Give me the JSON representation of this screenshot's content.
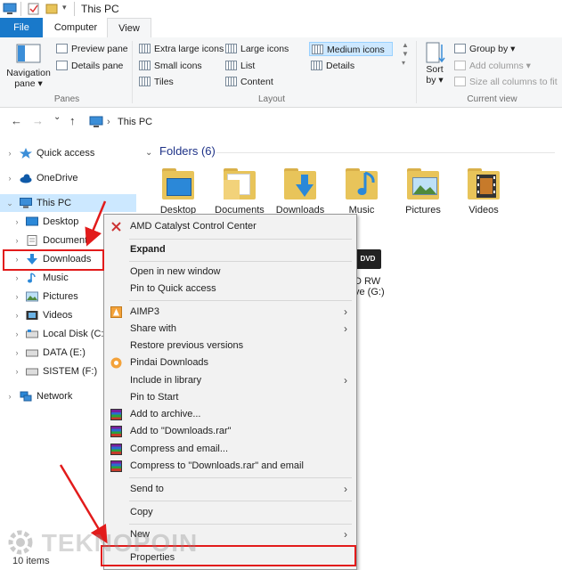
{
  "window": {
    "title": "This PC"
  },
  "ribbon_tabs": {
    "file": "File",
    "computer": "Computer",
    "view": "View"
  },
  "ribbon": {
    "panes": {
      "nav_pane_line1": "Navigation",
      "nav_pane_line2": "pane ▾",
      "preview_pane": "Preview pane",
      "details_pane": "Details pane",
      "label": "Panes"
    },
    "layout": {
      "extra_large": "Extra large icons",
      "large": "Large icons",
      "medium": "Medium icons",
      "small": "Small icons",
      "list": "List",
      "details": "Details",
      "tiles": "Tiles",
      "content": "Content",
      "label": "Layout"
    },
    "current_view": {
      "sort_line1": "Sort",
      "sort_line2": "by ▾",
      "group_by": "Group by ▾",
      "add_columns": "Add columns ▾",
      "size_all": "Size all columns to fit",
      "label": "Current view"
    }
  },
  "address": {
    "back": "←",
    "forward": "→",
    "dropdown": "⌄",
    "up": "↑",
    "sep": "›",
    "crumb": "This PC"
  },
  "nav": {
    "quick_access": "Quick access",
    "onedrive": "OneDrive",
    "this_pc": "This PC",
    "desktop": "Desktop",
    "documents": "Document",
    "downloads": "Downloads",
    "music": "Music",
    "pictures": "Pictures",
    "videos": "Videos",
    "local_disk": "Local Disk (C:)",
    "data": "DATA  (E:)",
    "sistem": "SISTEM  (F:)",
    "network": "Network"
  },
  "main": {
    "folders_header": "Folders (6)",
    "folders": [
      "Desktop",
      "Documents",
      "Downloads",
      "Music",
      "Pictures",
      "Videos"
    ],
    "dvd_label_1": "DVD",
    "dvd_label_2": "D RW",
    "dvd_label_3": "ve (G:)"
  },
  "context_menu": {
    "amd": "AMD Catalyst Control Center",
    "expand": "Expand",
    "open_new_window": "Open in new window",
    "pin_quick": "Pin to Quick access",
    "aimp": "AIMP3",
    "share_with": "Share with",
    "restore": "Restore previous versions",
    "pindai": "Pindai Downloads",
    "include_library": "Include in library",
    "pin_start": "Pin to Start",
    "add_archive": "Add to archive...",
    "add_rar": "Add to \"Downloads.rar\"",
    "compress_email": "Compress and email...",
    "compress_rar_email": "Compress to \"Downloads.rar\" and email",
    "send_to": "Send to",
    "copy": "Copy",
    "new": "New",
    "properties": "Properties",
    "submenu_arrow": "›"
  },
  "status": {
    "items": "10 items"
  },
  "watermark": "TEKNOPOIN",
  "colors": {
    "accent": "#1979ca",
    "highlight": "#e21b1b",
    "selection": "#cce8ff"
  }
}
